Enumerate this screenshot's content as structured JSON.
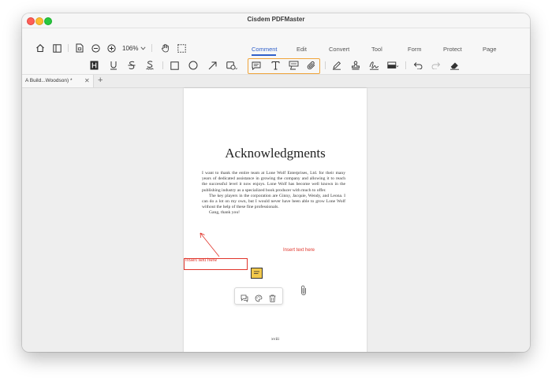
{
  "window": {
    "title": "Cisdem PDFMaster"
  },
  "toolbar": {
    "zoom": "106%",
    "tabs": [
      {
        "label": "Comment",
        "active": true
      },
      {
        "label": "Edit"
      },
      {
        "label": "Convert"
      },
      {
        "label": "Tool"
      },
      {
        "label": "Form"
      },
      {
        "label": "Protect"
      },
      {
        "label": "Page"
      }
    ],
    "icons": [
      "home-icon",
      "sidebar-icon",
      "page-icon",
      "zoom-out-icon",
      "zoom-in-icon",
      "hand-icon",
      "selection-icon",
      "highlight-icon",
      "underline-icon",
      "strikethrough-icon",
      "squiggly-icon",
      "rectangle-icon",
      "ellipse-icon",
      "arrow-icon",
      "shape-menu-icon",
      "note-icon",
      "text-box-icon",
      "callout-icon",
      "attachment-icon",
      "pen-icon",
      "stamp-icon",
      "signature-icon",
      "measure-icon",
      "undo-icon",
      "redo-icon",
      "eraser-icon"
    ],
    "accent_color": "#3160c9",
    "selected_group_color": "#f0a53a"
  },
  "doc_tabs": [
    {
      "label": "A Build...Woodson) *"
    }
  ],
  "page": {
    "title": "Acknowledgments",
    "paragraphs": [
      "I want to thank the entire team at Lone Wolf Enterprises, Ltd. for their many years of dedicated assistance in growing the company and allowing it to reach the successful level it now enjoys. Lone Wolf has become well known in the publishing industry as a specialized book producer with much to offer.",
      "The key players in the corporation are Ginny, Jacquie, Wendy, and Leona. I can do a lot on my own, but I would never have been able to grow Lone Wolf without the help of these fine professionals.",
      "Gang, thank you!"
    ],
    "page_number": "xviii",
    "annotations": {
      "text_box_1": "Insert text here",
      "text_box_2": "Insert text here",
      "annotation_color": "#e0342a"
    }
  }
}
